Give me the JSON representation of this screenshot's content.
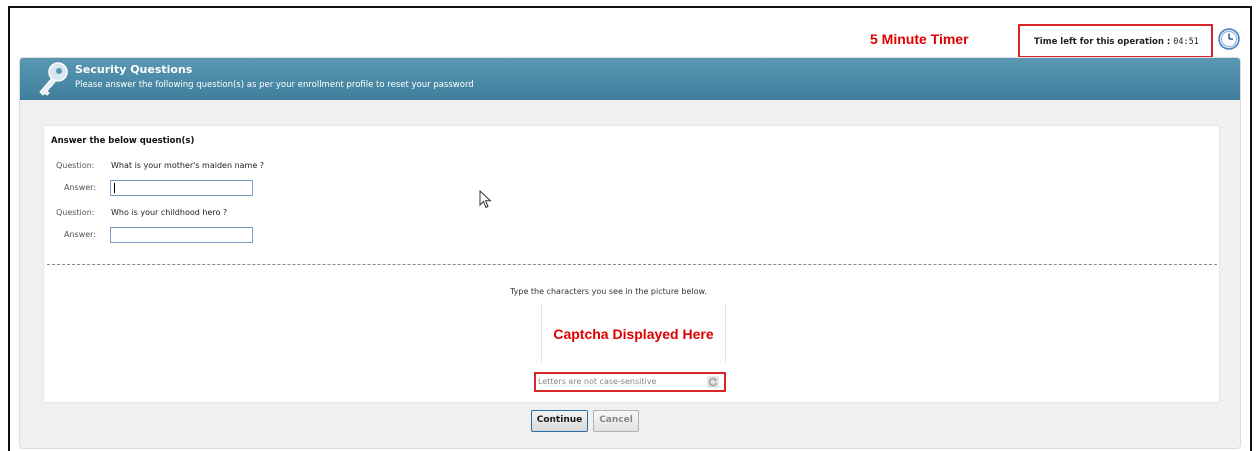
{
  "annotations": {
    "timer_label": "5 Minute Timer",
    "captcha_label": "Captcha Displayed Here"
  },
  "timer": {
    "label": "Time left for this operation :",
    "value": "04:51",
    "icon": "clock-icon"
  },
  "header": {
    "icon": "key-icon",
    "title": "Security Questions",
    "subtitle": "Please answer the following question(s) as per your enrollment profile to reset your password"
  },
  "form": {
    "section_title": "Answer the below question(s)",
    "questions": [
      {
        "question_label": "Question:",
        "question": "What is your mother's maiden name ?",
        "answer_label": "Answer:",
        "answer_value": ""
      },
      {
        "question_label": "Question:",
        "question": "Who is your childhood hero ?",
        "answer_label": "Answer:",
        "answer_value": ""
      }
    ]
  },
  "captcha": {
    "instruction": "Type the characters you see in the picture below.",
    "input_placeholder": "Letters are not case-sensitive",
    "refresh_icon": "refresh-icon"
  },
  "buttons": {
    "continue": "Continue",
    "cancel": "Cancel"
  },
  "colors": {
    "header": "#4a8aa6",
    "annotation_red": "#e00000",
    "highlight_border": "#d9262b"
  }
}
